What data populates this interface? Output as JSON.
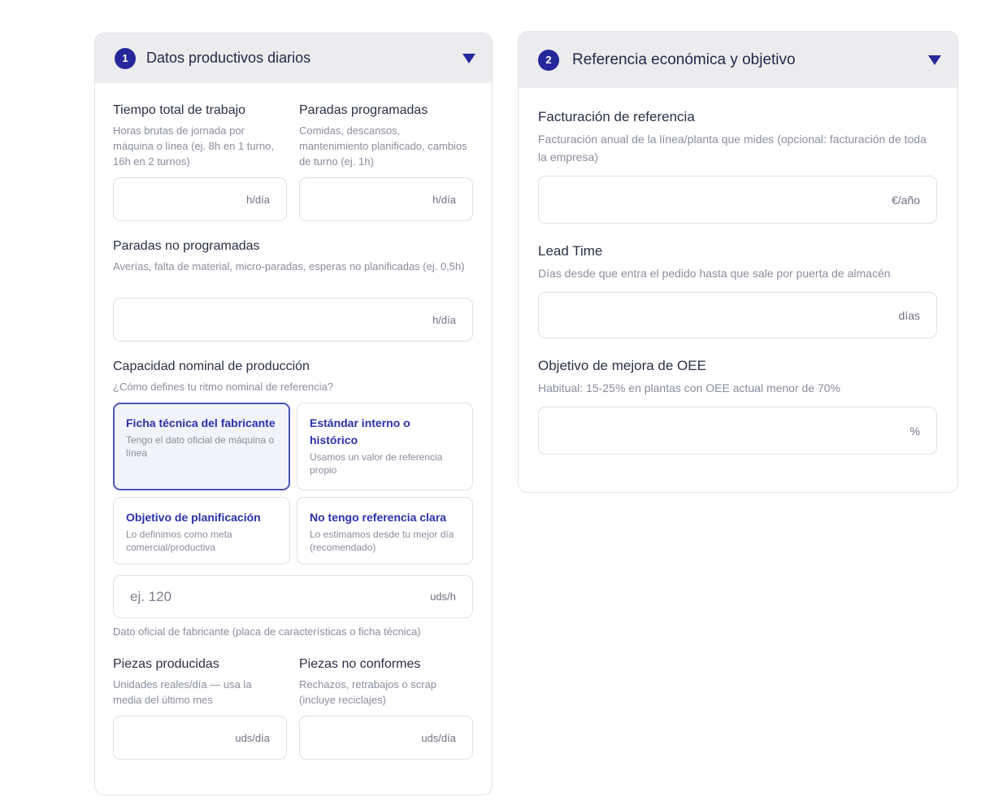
{
  "section1": {
    "step": "1",
    "title": "Datos productivos diarios",
    "tiempo_total": {
      "label": "Tiempo total de trabajo",
      "help": "Horas brutas de jornada por máquina o línea (ej. 8h en 1 turno, 16h en 2 turnos)",
      "value": "",
      "placeholder": "",
      "unit": "h/día"
    },
    "paradas_programadas": {
      "label": "Paradas programadas",
      "help": "Comidas, descansos, mantenimiento planificado, cambios de turno (ej. 1h)",
      "value": "",
      "placeholder": "",
      "unit": "h/día"
    },
    "paradas_no_programadas": {
      "label": "Paradas no programadas",
      "help": "Averías, falta de material, micro-paradas, esperas no planificadas (ej. 0,5h)",
      "value": "",
      "placeholder": "",
      "unit": "h/día"
    },
    "capacidad": {
      "label": "Capacidad nominal de producción",
      "help": "¿Cómo defines tu ritmo nominal de referencia?",
      "options": [
        {
          "title": "Ficha técnica del fabricante",
          "desc": "Tengo el dato oficial de máquina o línea",
          "selected": true
        },
        {
          "title": "Estándar interno o histórico",
          "desc": "Usamos un valor de referencia propio",
          "selected": false
        },
        {
          "title": "Objetivo de planificación",
          "desc": "Lo definimos como meta comercial/productiva",
          "selected": false
        },
        {
          "title": "No tengo referencia clara",
          "desc": "Lo estimamos desde tu mejor día (recomendado)",
          "selected": false
        }
      ],
      "value": "",
      "placeholder": "ej. 120",
      "unit": "uds/h",
      "note": "Dato oficial de fabricante (placa de características o ficha técnica)"
    },
    "piezas_producidas": {
      "label": "Piezas producidas",
      "help": "Unidades reales/día — usa la media del último mes",
      "value": "",
      "placeholder": "",
      "unit": "uds/día"
    },
    "piezas_no_conformes": {
      "label": "Piezas no conformes",
      "help": "Rechazos, retrabajos o scrap (incluye reciclajes)",
      "value": "",
      "placeholder": "",
      "unit": "uds/día"
    }
  },
  "section2": {
    "step": "2",
    "title": "Referencia económica y objetivo",
    "facturacion": {
      "label": "Facturación de referencia",
      "help": "Facturación anual de la línea/planta que mides (opcional: facturación de toda la empresa)",
      "value": "",
      "placeholder": "",
      "unit": "€/año"
    },
    "lead_time": {
      "label": "Lead Time",
      "help": "Días desde que entra el pedido hasta que sale por puerta de almacén",
      "value": "",
      "placeholder": "",
      "unit": "días"
    },
    "objetivo_oee": {
      "label": "Objetivo de mejora de OEE",
      "help": "Habitual: 15-25% en plantas con OEE actual menor de 70%",
      "value": "",
      "placeholder": "",
      "unit": "%"
    }
  },
  "icons": {
    "collapse": "caret-down-icon"
  },
  "colors": {
    "accent": "#24279a",
    "header_bg": "#ececef",
    "option_title": "#2a31a8",
    "selected_bg": "#f2f3fb"
  }
}
